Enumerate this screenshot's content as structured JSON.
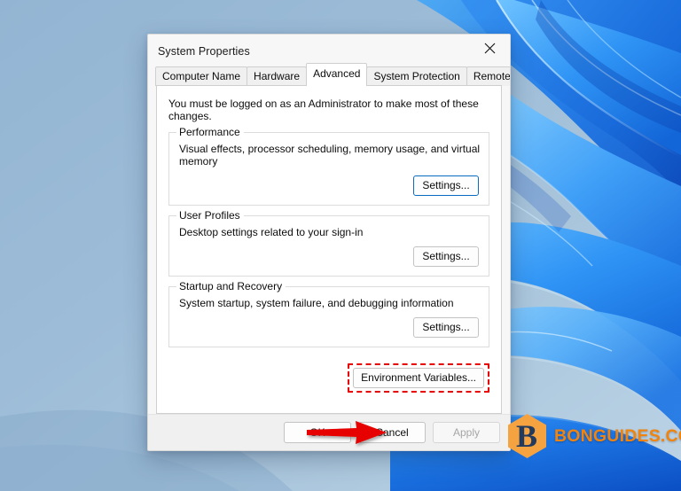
{
  "wallpaper": {
    "name": "windows-11-bloom-wallpaper"
  },
  "dialog": {
    "title": "System Properties",
    "close_icon": "close-icon",
    "tabs": [
      {
        "label": "Computer Name",
        "active": false
      },
      {
        "label": "Hardware",
        "active": false
      },
      {
        "label": "Advanced",
        "active": true
      },
      {
        "label": "System Protection",
        "active": false
      },
      {
        "label": "Remote",
        "active": false
      }
    ],
    "notice": "You must be logged on as an Administrator to make most of these changes.",
    "groups": [
      {
        "legend": "Performance",
        "description": "Visual effects, processor scheduling, memory usage, and virtual memory",
        "button_label": "Settings...",
        "button_focused": true
      },
      {
        "legend": "User Profiles",
        "description": "Desktop settings related to your sign-in",
        "button_label": "Settings...",
        "button_focused": false
      },
      {
        "legend": "Startup and Recovery",
        "description": "System startup, system failure, and debugging information",
        "button_label": "Settings...",
        "button_focused": false
      }
    ],
    "environment_variables_button": "Environment Variables...",
    "footer": {
      "ok_label": "OK",
      "cancel_label": "Cancel",
      "apply_label": "Apply",
      "apply_disabled": true
    }
  },
  "annotations": {
    "arrow_color": "#e60000",
    "highlight_color": "#e80000",
    "arrow_name": "red-pointer-arrow",
    "highlight_target": "Environment Variables..."
  },
  "watermark": {
    "text": "BONGUIDES.COM",
    "logo_letter": "B",
    "logo_color": "#f5a341",
    "text_color": "#f0840f"
  }
}
